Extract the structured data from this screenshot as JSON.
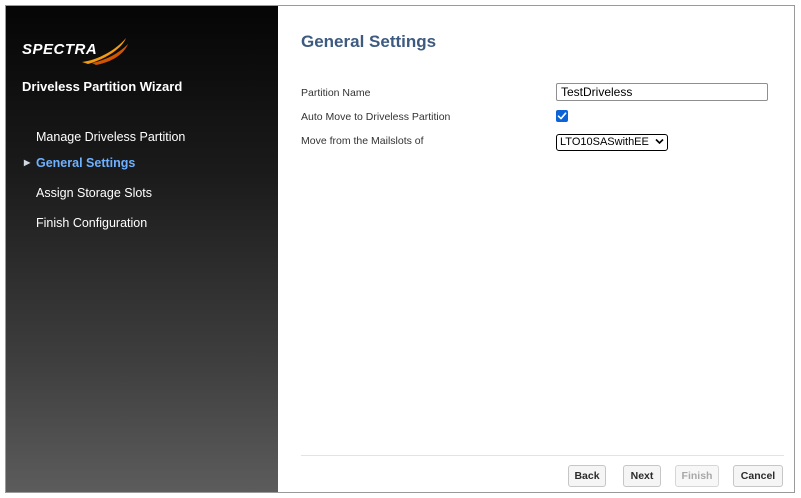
{
  "brand": {
    "logo_text": "SPECTRA",
    "accent_color": "#f39c12"
  },
  "sidebar": {
    "wizard_title": "Driveless Partition Wizard",
    "steps": [
      {
        "label": "Manage Driveless Partition",
        "active": false
      },
      {
        "label": "General Settings",
        "active": true
      },
      {
        "label": "Assign Storage Slots",
        "active": false
      },
      {
        "label": "Finish Configuration",
        "active": false
      }
    ]
  },
  "main": {
    "title": "General Settings",
    "fields": {
      "partition_name": {
        "label": "Partition Name",
        "value": "TestDriveless"
      },
      "auto_move": {
        "label": "Auto Move to Driveless Partition",
        "checked": true
      },
      "mailslots": {
        "label": "Move from the Mailslots of",
        "selected": "LTO10SASwithEE"
      }
    }
  },
  "footer": {
    "back_label": "Back",
    "next_label": "Next",
    "finish_label": "Finish",
    "cancel_label": "Cancel"
  }
}
